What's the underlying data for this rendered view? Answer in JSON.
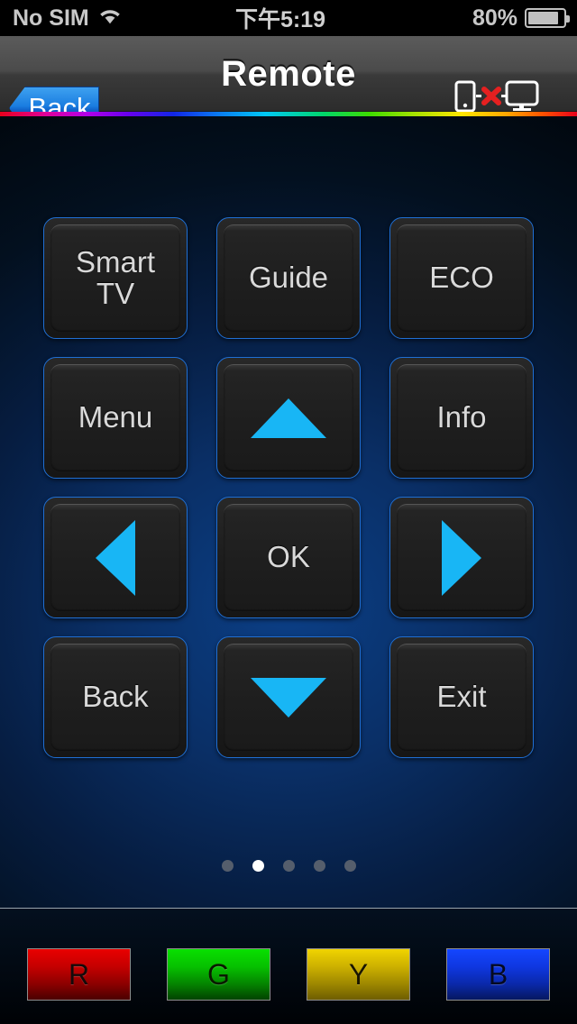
{
  "status_bar": {
    "carrier": "No SIM",
    "wifi_icon": "wifi-icon",
    "time": "下午5:19",
    "battery_percent": "80%",
    "battery_icon": "battery-icon"
  },
  "nav_bar": {
    "back_label": "Back",
    "title": "Remote",
    "connection": {
      "icon": "phone-disconnected-tv-icon",
      "label": "disconnected",
      "x_mark_color": "#e52020"
    }
  },
  "theme": {
    "accent_blue": "#1f6fd4",
    "arrow_blue": "#18b6f5",
    "key_face": "#1e1e1e",
    "key_text": "#d9d9d9",
    "background_center": "#0b3f86"
  },
  "remote": {
    "keys": [
      {
        "id": "smart-tv",
        "label": "Smart\nTV",
        "type": "text"
      },
      {
        "id": "guide",
        "label": "Guide",
        "type": "text"
      },
      {
        "id": "eco",
        "label": "ECO",
        "type": "text"
      },
      {
        "id": "menu",
        "label": "Menu",
        "type": "text"
      },
      {
        "id": "up",
        "label": "",
        "type": "arrow-up"
      },
      {
        "id": "info",
        "label": "Info",
        "type": "text"
      },
      {
        "id": "left",
        "label": "",
        "type": "arrow-left"
      },
      {
        "id": "ok",
        "label": "OK",
        "type": "text"
      },
      {
        "id": "right",
        "label": "",
        "type": "arrow-right"
      },
      {
        "id": "back",
        "label": "Back",
        "type": "text"
      },
      {
        "id": "down",
        "label": "",
        "type": "arrow-down"
      },
      {
        "id": "exit",
        "label": "Exit",
        "type": "text"
      }
    ]
  },
  "pagination": {
    "total": 5,
    "active_index": 1
  },
  "color_keys": [
    {
      "id": "red",
      "label": "R",
      "color": "#e90000"
    },
    {
      "id": "green",
      "label": "G",
      "color": "#09e000"
    },
    {
      "id": "yellow",
      "label": "Y",
      "color": "#f0d400"
    },
    {
      "id": "blue",
      "label": "B",
      "color": "#1446ff"
    }
  ]
}
